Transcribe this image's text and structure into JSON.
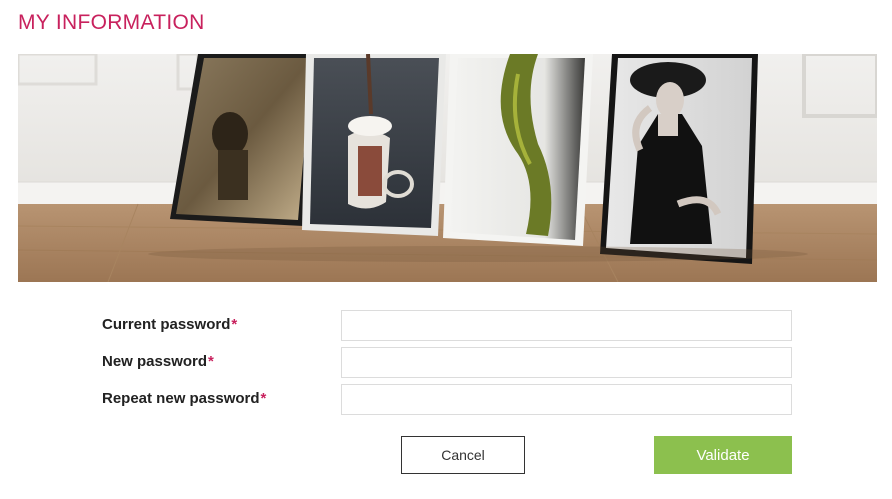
{
  "page": {
    "title": "MY INFORMATION"
  },
  "banner": {
    "icon": "framed-photos-banner"
  },
  "form": {
    "required_marker": "*",
    "fields": [
      {
        "label": "Current password",
        "value": "",
        "placeholder": ""
      },
      {
        "label": "New password",
        "value": "",
        "placeholder": ""
      },
      {
        "label": "Repeat new password",
        "value": "",
        "placeholder": ""
      }
    ],
    "cancel_label": "Cancel",
    "validate_label": "Validate"
  },
  "colors": {
    "accent": "#c8215d",
    "validate": "#8cc04e"
  }
}
